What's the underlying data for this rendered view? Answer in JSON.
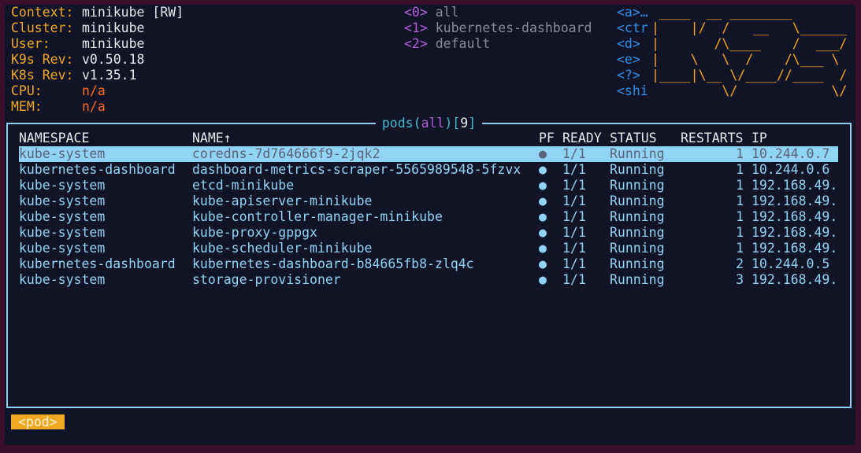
{
  "info": [
    {
      "key": "Context:",
      "value": "minikube [RW]"
    },
    {
      "key": "Cluster:",
      "value": "minikube"
    },
    {
      "key": "User:",
      "value": "minikube"
    },
    {
      "key": "K9s Rev:",
      "value": "v0.50.18"
    },
    {
      "key": "K8s Rev:",
      "value": "v1.35.1"
    },
    {
      "key": "CPU:",
      "value": "n/a"
    },
    {
      "key": "MEM:",
      "value": "n/a"
    }
  ],
  "namespaces": [
    {
      "key": "<0>",
      "label": "all"
    },
    {
      "key": "<1>",
      "label": "kubernetes-dashboard"
    },
    {
      "key": "<2>",
      "label": "default"
    }
  ],
  "hotkeys": [
    "<a>…",
    "<ctr",
    "<d>",
    "<e>",
    "<?>",
    "<shi"
  ],
  "logo": [
    " ____  __ ________",
    "|    |/  /   __   \\______",
    "|       /\\____    /  ___/",
    "|    \\   \\  /    /\\___ \\",
    "|____|\\__ \\/____//____  /",
    "         \\/            \\/"
  ],
  "panel": {
    "resource": "pods",
    "namespace": "all",
    "count": "9"
  },
  "headers": {
    "namespace": "NAMESPACE",
    "name": "NAME",
    "sort_arrow": "↑",
    "pf": "PF",
    "ready": "READY",
    "status": "STATUS",
    "restarts": "RESTARTS",
    "ip": "IP"
  },
  "pods": [
    {
      "namespace": "kube-system",
      "name": "coredns-7d764666f9-2jqk2",
      "pf": "●",
      "ready": "1/1",
      "status": "Running",
      "restarts": "1",
      "ip": "10.244.0.7"
    },
    {
      "namespace": "kubernetes-dashboard",
      "name": "dashboard-metrics-scraper-5565989548-5fzvx",
      "pf": "●",
      "ready": "1/1",
      "status": "Running",
      "restarts": "1",
      "ip": "10.244.0.6"
    },
    {
      "namespace": "kube-system",
      "name": "etcd-minikube",
      "pf": "●",
      "ready": "1/1",
      "status": "Running",
      "restarts": "1",
      "ip": "192.168.49."
    },
    {
      "namespace": "kube-system",
      "name": "kube-apiserver-minikube",
      "pf": "●",
      "ready": "1/1",
      "status": "Running",
      "restarts": "1",
      "ip": "192.168.49."
    },
    {
      "namespace": "kube-system",
      "name": "kube-controller-manager-minikube",
      "pf": "●",
      "ready": "1/1",
      "status": "Running",
      "restarts": "1",
      "ip": "192.168.49."
    },
    {
      "namespace": "kube-system",
      "name": "kube-proxy-gppgx",
      "pf": "●",
      "ready": "1/1",
      "status": "Running",
      "restarts": "1",
      "ip": "192.168.49."
    },
    {
      "namespace": "kube-system",
      "name": "kube-scheduler-minikube",
      "pf": "●",
      "ready": "1/1",
      "status": "Running",
      "restarts": "1",
      "ip": "192.168.49."
    },
    {
      "namespace": "kubernetes-dashboard",
      "name": "kubernetes-dashboard-b84665fb8-zlq4c",
      "pf": "●",
      "ready": "1/1",
      "status": "Running",
      "restarts": "2",
      "ip": "10.244.0.5"
    },
    {
      "namespace": "kube-system",
      "name": "storage-provisioner",
      "pf": "●",
      "ready": "1/1",
      "status": "Running",
      "restarts": "3",
      "ip": "192.168.49."
    }
  ],
  "crumb": "<pod>",
  "colors": {
    "background": "#111426",
    "frame": "#3a0f2a",
    "accent": "#f0a722",
    "row_text": "#8fd4f4",
    "namespace_key": "#b05fd8",
    "hotkey": "#2f8fe6",
    "warn": "#ff6a1a"
  }
}
